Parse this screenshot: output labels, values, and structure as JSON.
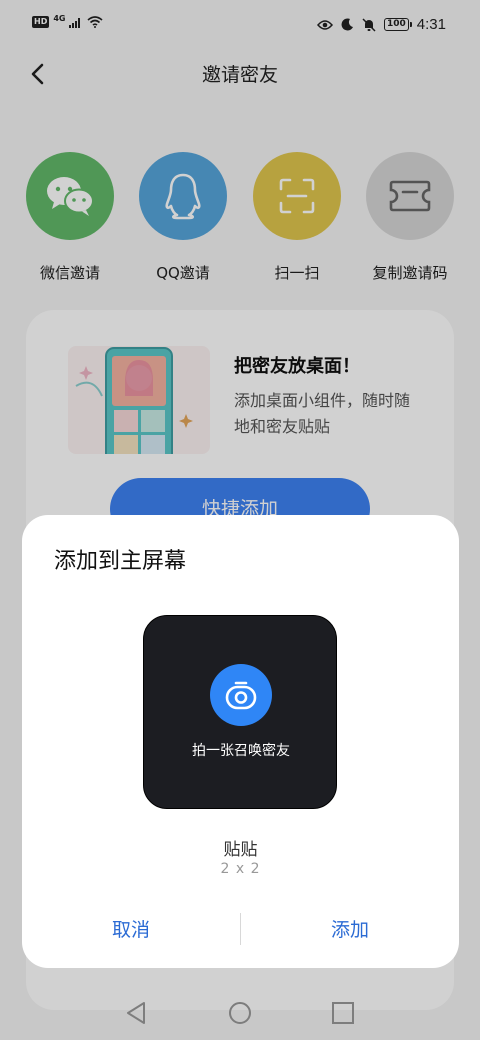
{
  "status_bar": {
    "network_hd": "HD",
    "network_type": "4G",
    "battery": "100",
    "time": "4:31"
  },
  "header": {
    "title": "邀请密友"
  },
  "share_options": [
    {
      "label": "微信邀请",
      "icon": "wechat-icon",
      "color": "#62b96a"
    },
    {
      "label": "QQ邀请",
      "icon": "qq-penguin-icon",
      "color": "#56a5db"
    },
    {
      "label": "扫一扫",
      "icon": "scan-icon",
      "color": "#e0c64e"
    },
    {
      "label": "复制邀请码",
      "icon": "ticket-icon",
      "color": "#d6d6d6"
    }
  ],
  "promo": {
    "title": "把密友放桌面！",
    "description": "添加桌面小组件，随时随地和密友贴贴",
    "button_label": "快捷添加"
  },
  "dialog": {
    "title": "添加到主屏幕",
    "widget_caption": "拍一张召唤密友",
    "widget_name": "贴贴",
    "widget_size": "2 x 2",
    "cancel_label": "取消",
    "add_label": "添加"
  },
  "colors": {
    "accent": "#2b6bd4",
    "widget_bg": "#1c1d22",
    "camera_button": "#2f86f6"
  }
}
